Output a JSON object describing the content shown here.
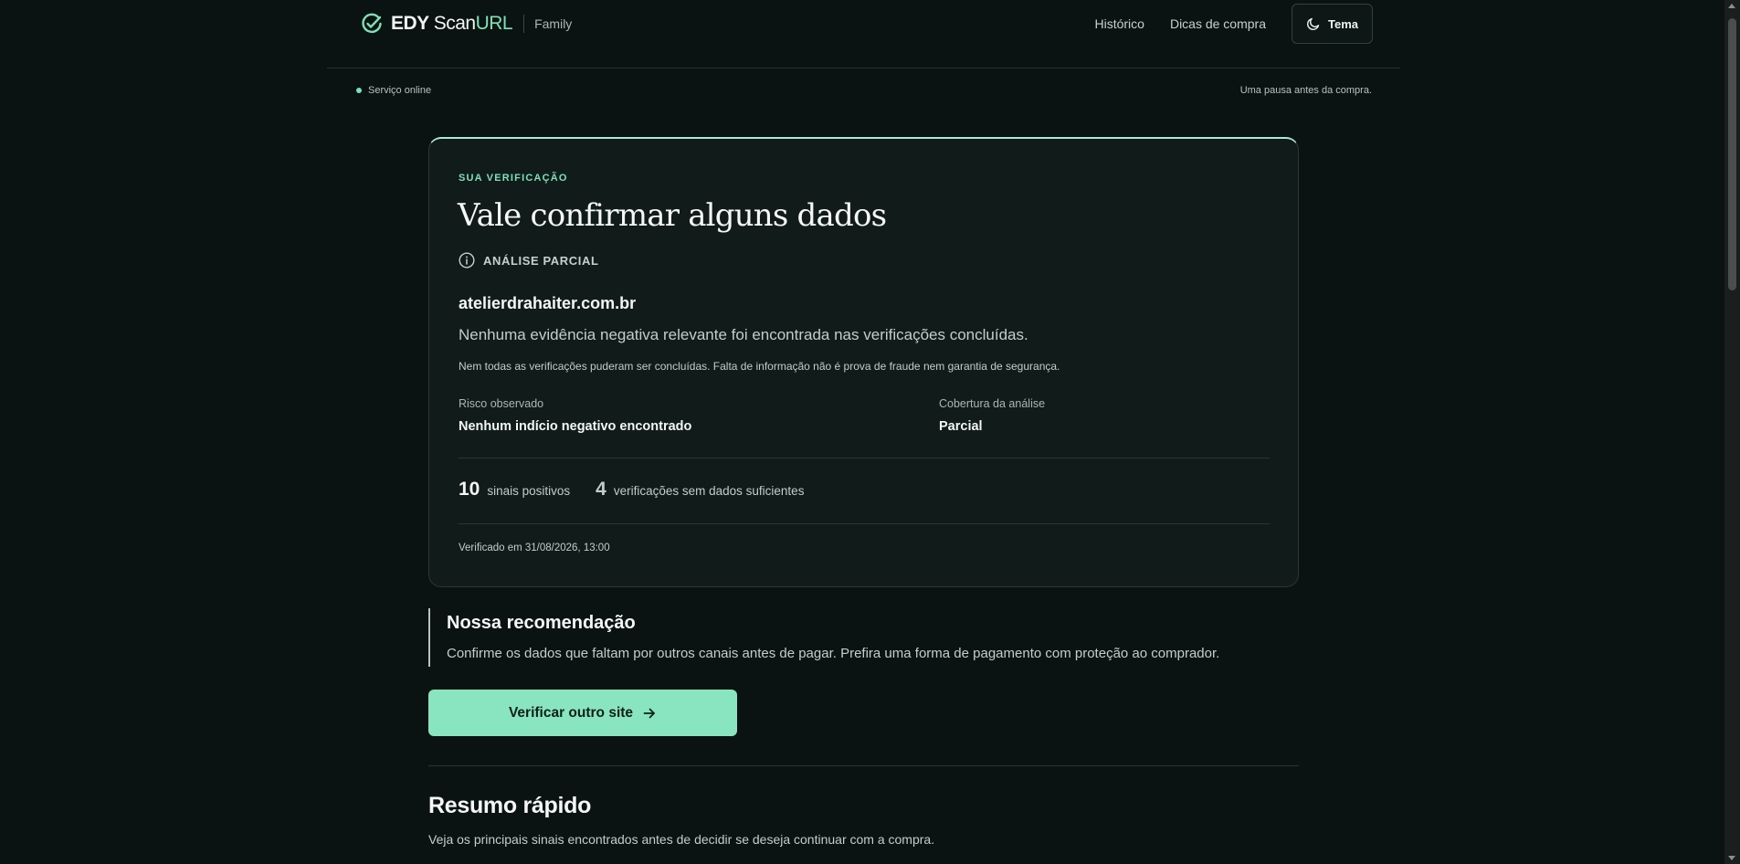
{
  "header": {
    "brand_edy": "EDY",
    "brand_scan": "Scan",
    "brand_url": "URL",
    "brand_family": "Family",
    "nav": [
      {
        "label": "Histórico"
      },
      {
        "label": "Dicas de compra"
      }
    ],
    "theme_label": "Tema"
  },
  "status": {
    "service_text": "Serviço online",
    "tagline": "Uma pausa antes da compra."
  },
  "card": {
    "eyebrow": "SUA VERIFICAÇÃO",
    "title": "Vale confirmar alguns dados",
    "analysis_badge": "ANÁLISE PARCIAL",
    "domain": "atelierdrahaiter.com.br",
    "summary": "Nenhuma evidência negativa relevante foi encontrada nas verificações concluídas.",
    "disclaimer": "Nem todas as verificações puderam ser concluídas. Falta de informação não é prova de fraude nem garantia de segurança.",
    "risk": {
      "label": "Risco observado",
      "value": "Nenhum indício negativo encontrado"
    },
    "coverage": {
      "label": "Cobertura da análise",
      "value": "Parcial"
    },
    "positive_count": "10",
    "positive_label": "sinais positivos",
    "insufficient_count": "4",
    "insufficient_label": "verificações sem dados suficientes",
    "verified_at": "Verificado em 31/08/2026, 13:00"
  },
  "recommendation": {
    "title": "Nossa recomendação",
    "text": "Confirme os dados que faltam por outros canais antes de pagar. Prefira uma forma de pagamento com proteção ao comprador."
  },
  "cta": {
    "label": "Verificar outro site"
  },
  "quick_summary": {
    "title": "Resumo rápido",
    "subtitle": "Veja os principais sinais encontrados antes de decidir se deseja continuar com a compra."
  },
  "colors": {
    "accent": "#7fe0b8",
    "cta_bg": "#89e5c0",
    "background": "#0a1312",
    "card_bg": "#111c1a"
  }
}
